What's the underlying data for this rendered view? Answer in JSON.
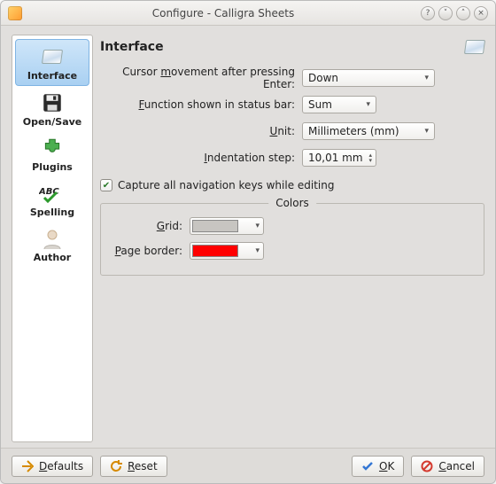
{
  "window": {
    "title": "Configure - Calligra Sheets"
  },
  "sidebar": {
    "items": [
      {
        "label": "Interface"
      },
      {
        "label": "Open/Save"
      },
      {
        "label": "Plugins"
      },
      {
        "label": "Spelling"
      },
      {
        "label": "Author"
      }
    ]
  },
  "page": {
    "heading": "Interface",
    "cursor_label_pre": "Cursor ",
    "cursor_label_ul": "m",
    "cursor_label_post": "ovement after pressing Enter:",
    "cursor_value": "Down",
    "func_label_ul": "F",
    "func_label_post": "unction shown in status bar:",
    "func_value": "Sum",
    "unit_label_ul": "U",
    "unit_label_post": "nit:",
    "unit_value": "Millimeters (mm)",
    "indent_label_ul": "I",
    "indent_label_post": "ndentation step:",
    "indent_value": "10,01 mm",
    "capture_label_pre": "Capture ",
    "capture_label_ul": "a",
    "capture_label_post": "ll navigation keys while editing",
    "capture_checked": true,
    "colors_title": "Colors",
    "grid_label_ul": "G",
    "grid_label_post": "rid:",
    "grid_color": "#c7c5c1",
    "pageborder_label_ul": "P",
    "pageborder_label_post": "age border:",
    "pageborder_color": "#ff0000"
  },
  "footer": {
    "defaults_ul": "D",
    "defaults_post": "efaults",
    "reset_ul": "R",
    "reset_post": "eset",
    "ok_ul": "O",
    "ok_post": "K",
    "cancel_ul": "C",
    "cancel_post": "ancel"
  }
}
